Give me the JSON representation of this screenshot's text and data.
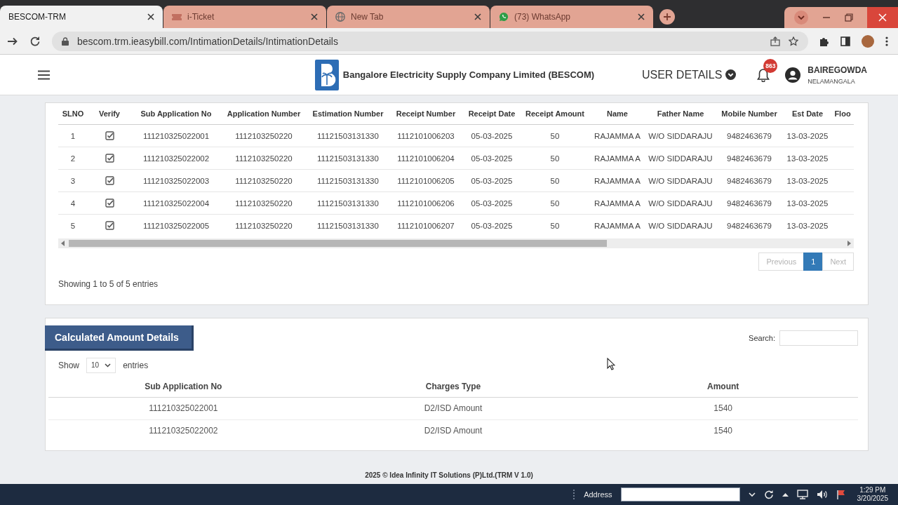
{
  "browser": {
    "tabs": [
      {
        "title": "BESCOM-TRM",
        "kind": "plain",
        "selected": true
      },
      {
        "title": "i-Ticket",
        "kind": "ticket",
        "selected": false
      },
      {
        "title": "New Tab",
        "kind": "globe",
        "selected": false
      },
      {
        "title": "(73) WhatsApp",
        "kind": "chat",
        "selected": false
      }
    ],
    "url": "bescom.trm.ieasybill.com/IntimationDetails/IntimationDetails"
  },
  "header": {
    "title": "Bangalore Electricity Supply Company Limited (BESCOM)",
    "user_details": "USER DETAILS",
    "notification_count": "863",
    "user_name": "BAIREGOWDA",
    "user_location": "NELAMANGALA"
  },
  "intimation_table": {
    "columns": [
      "SLNO",
      "Verify",
      "Sub Application No",
      "Application Number",
      "Estimation Number",
      "Receipt Number",
      "Receipt Date",
      "Receipt Amount",
      "Name",
      "Father Name",
      "Mobile Number",
      "Est Date",
      "Floo"
    ],
    "rows": [
      {
        "slno": "1",
        "checked": true,
        "values": [
          "111210325022001",
          "1112103250220",
          "11121503131330",
          "1112101006203",
          "05-03-2025",
          "50",
          "RAJAMMA A",
          "W/O SIDDARAJU",
          "9482463679",
          "13-03-2025"
        ]
      },
      {
        "slno": "2",
        "checked": true,
        "values": [
          "111210325022002",
          "1112103250220",
          "11121503131330",
          "1112101006204",
          "05-03-2025",
          "50",
          "RAJAMMA A",
          "W/O SIDDARAJU",
          "9482463679",
          "13-03-2025"
        ]
      },
      {
        "slno": "3",
        "checked": true,
        "values": [
          "111210325022003",
          "1112103250220",
          "11121503131330",
          "1112101006205",
          "05-03-2025",
          "50",
          "RAJAMMA A",
          "W/O SIDDARAJU",
          "9482463679",
          "13-03-2025"
        ]
      },
      {
        "slno": "4",
        "checked": true,
        "values": [
          "111210325022004",
          "1112103250220",
          "11121503131330",
          "1112101006206",
          "05-03-2025",
          "50",
          "RAJAMMA A",
          "W/O SIDDARAJU",
          "9482463679",
          "13-03-2025"
        ]
      },
      {
        "slno": "5",
        "checked": true,
        "values": [
          "111210325022005",
          "1112103250220",
          "11121503131330",
          "1112101006207",
          "05-03-2025",
          "50",
          "RAJAMMA A",
          "W/O SIDDARAJU",
          "9482463679",
          "13-03-2025"
        ]
      }
    ],
    "pagination": {
      "previous": {
        "label": "Previous",
        "disabled": true
      },
      "pages": [
        {
          "label": "1",
          "selected": true
        }
      ],
      "next": {
        "label": "Next",
        "disabled": true
      }
    },
    "info": "Showing 1 to 5 of 5 entries"
  },
  "calculated_amount": {
    "title": "Calculated Amount Details",
    "search_label": "Search:",
    "show_label": "Show",
    "page_size": "10",
    "entries_label": "entries",
    "columns": [
      "Sub Application No",
      "Charges Type",
      "Amount"
    ],
    "rows": [
      [
        "111210325022001",
        "D2/ISD Amount",
        "1540"
      ],
      [
        "111210325022002",
        "D2/ISD Amount",
        "1540"
      ]
    ]
  },
  "footer": "2025 © Idea Infinity IT Solutions (P)Ltd.(TRM V 1.0)",
  "taskbar": {
    "address_label": "Address",
    "time": "1:29 PM",
    "date": "3/20/2025"
  }
}
